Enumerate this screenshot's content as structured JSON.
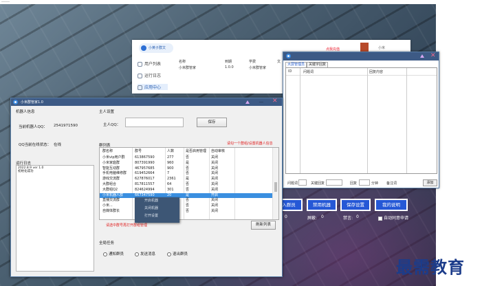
{
  "top_text": "……",
  "back_window": {
    "logo_text": "小黄子群文",
    "nav": [
      "用户列表",
      "运行日志",
      "应用中心"
    ],
    "headers": [
      "名称",
      "到期",
      "学费",
      "文"
    ],
    "row": [
      "小米群管家",
      "1.0.0",
      "小米群管家"
    ],
    "red_text": "点我充值",
    "username": "小米"
  },
  "right_window": {
    "tabs": [
      "大屏管理员",
      "关键字回复"
    ],
    "headers": [
      "ID",
      "问题词",
      "回复内容"
    ],
    "bottom_labels": [
      "问题词",
      "关键回复",
      "回复",
      "分钟",
      "备注词"
    ],
    "send_label": "添加"
  },
  "blue_buttons": [
    "入群员",
    "禁用机器",
    "保存设置",
    "我的说明"
  ],
  "bottom_status": {
    "left_value": "0",
    "mid_label": "屏蔽:",
    "mid_value": "0",
    "right_label": "禁言:",
    "right_value": "0",
    "checkbox_label": "自动同意申请"
  },
  "main_window": {
    "title": "小米群管家1.0",
    "robot_section": "机器人信息",
    "robot_qq_label": "当前机器人QQ：",
    "robot_qq_value": "2541971590",
    "online_label": "QQ当前在线状态：",
    "online_value": "在线",
    "log_label": "运行日志",
    "log_lines": [
      "2022.8.9 ver 1.0",
      "初始化成功"
    ],
    "owner_section": "主人设置",
    "owner_qq_label": "主人QQ：",
    "owner_save": "保存",
    "friend_section": "群列表",
    "friend_hint": "请勾一个群组/设置机器人信息",
    "table_headers": [
      "群名称",
      "群号",
      "人数",
      "是否启用管理",
      "自动审核"
    ],
    "rows": [
      [
        "小米vip用户群",
        "613867590",
        "277",
        "否",
        "关闭"
      ],
      [
        "小米家庭群",
        "807391990",
        "960",
        "是",
        "关闭"
      ],
      [
        "智能互动群",
        "467957685",
        "900",
        "否",
        "关闭"
      ],
      [
        "手机电脑维修群",
        "619452664",
        "7",
        "否",
        "关闭"
      ],
      [
        "游戏交流群",
        "627876017",
        "2361",
        "是",
        "关闭"
      ],
      [
        "大群组合",
        "817811557",
        "64",
        "否",
        "关闭"
      ],
      [
        "大群组Q2",
        "824624994",
        "301",
        "否",
        "关闭"
      ],
      [
        "小米机器人群",
        "667347590",
        "20",
        "是",
        "开启"
      ],
      [
        "直播交流群",
        "...",
        "...",
        "否",
        "关闭"
      ],
      [
        "小米...",
        "...",
        "...",
        "否",
        "关闭"
      ],
      [
        "自媒体群长",
        "...",
        "...",
        "否",
        "关闭"
      ]
    ],
    "context_menu": [
      "开启机器",
      "关闭机器",
      "打开设置"
    ],
    "table_note": "请选中群号再打开群组管理",
    "refresh_button": "刷新列表",
    "task_section": "全局任务",
    "radios": [
      "通知群员",
      "发送消息",
      "退出群员"
    ]
  },
  "watermark": "最需教育"
}
